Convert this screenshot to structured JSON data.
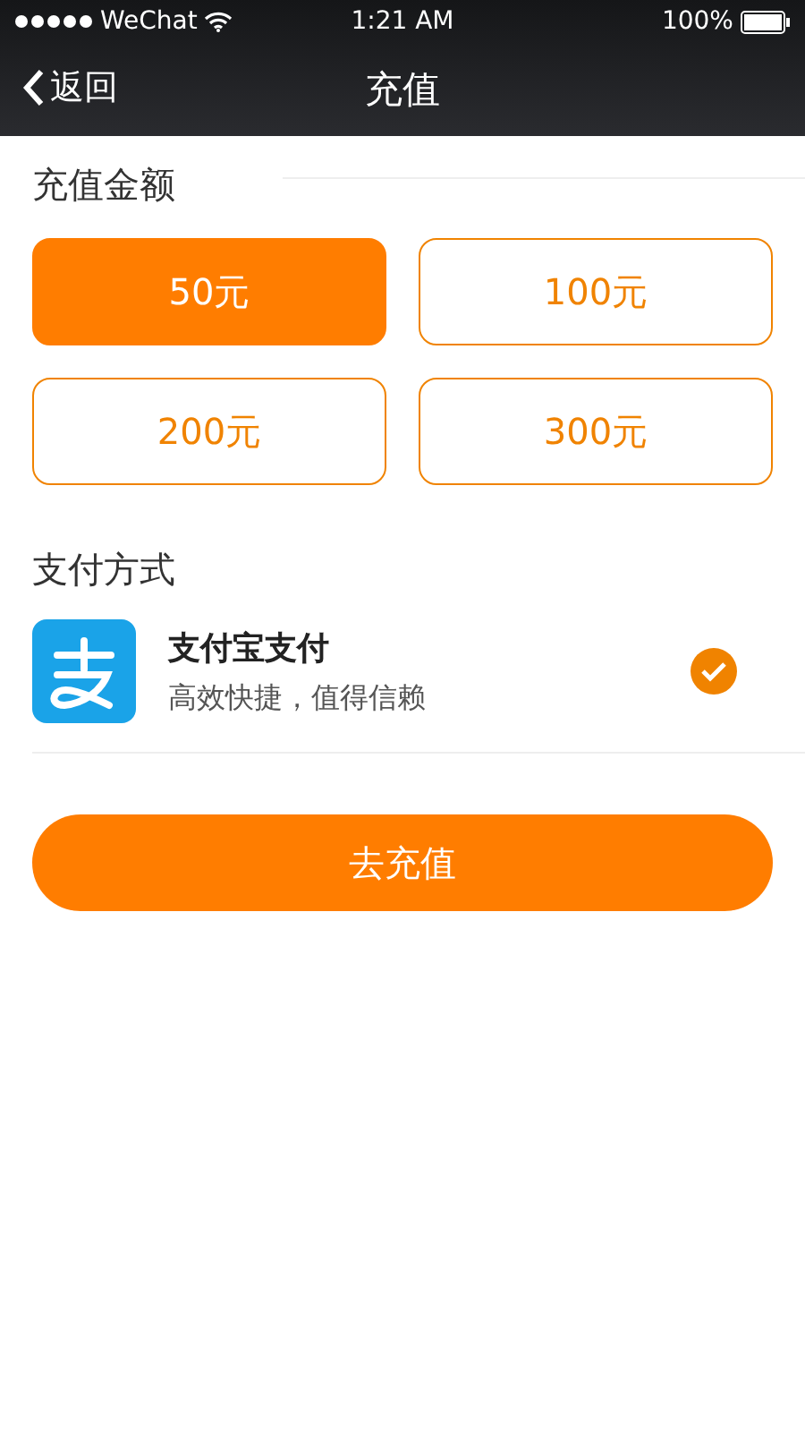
{
  "status_bar": {
    "carrier": "WeChat",
    "time": "1:21 AM",
    "battery": "100%"
  },
  "nav_bar": {
    "back": "返回",
    "title": "充值"
  },
  "amount": {
    "title": "充值金额",
    "options": [
      {
        "label": "50元",
        "selected": true
      },
      {
        "label": "100元",
        "selected": false
      },
      {
        "label": "200元",
        "selected": false
      },
      {
        "label": "300元",
        "selected": false
      }
    ]
  },
  "payment": {
    "title": "支付方式",
    "methods": [
      {
        "name": "支付宝支付",
        "description": "高效快捷，值得信赖",
        "selected": true
      }
    ]
  },
  "submit": "去充值"
}
